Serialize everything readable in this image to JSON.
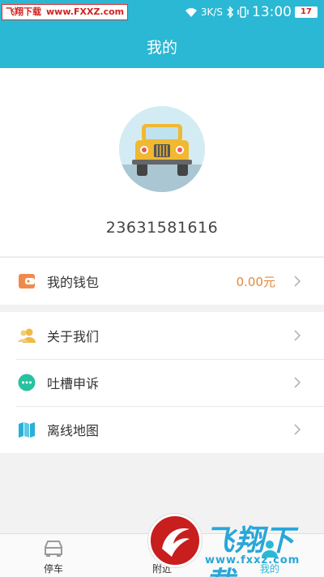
{
  "status_bar": {
    "watermark_site": "飞翔下载",
    "watermark_url": "www.FXXZ.com",
    "net_speed": "3K/S",
    "time": "13:00",
    "battery": "17"
  },
  "header": {
    "title": "我的"
  },
  "profile": {
    "phone": "23631581616"
  },
  "menu": {
    "wallet": {
      "label": "我的钱包",
      "value": "0.00元"
    },
    "items": [
      {
        "label": "关于我们",
        "icon": "people-icon"
      },
      {
        "label": "吐槽申诉",
        "icon": "chat-bubble-icon"
      },
      {
        "label": "离线地图",
        "icon": "map-icon"
      }
    ]
  },
  "tabbar": {
    "tabs": [
      {
        "label": "停车",
        "icon": "car-icon"
      },
      {
        "label": "附近",
        "icon": "location-icon"
      },
      {
        "label": "我的",
        "icon": "user-icon"
      }
    ],
    "active": "我的"
  },
  "watermark_bottom": {
    "text": "飞翔下载",
    "url": "www.fxxz.com"
  },
  "colors": {
    "primary": "#2ab8d4",
    "accent": "#e08a3a",
    "background": "#f2f2f2"
  }
}
